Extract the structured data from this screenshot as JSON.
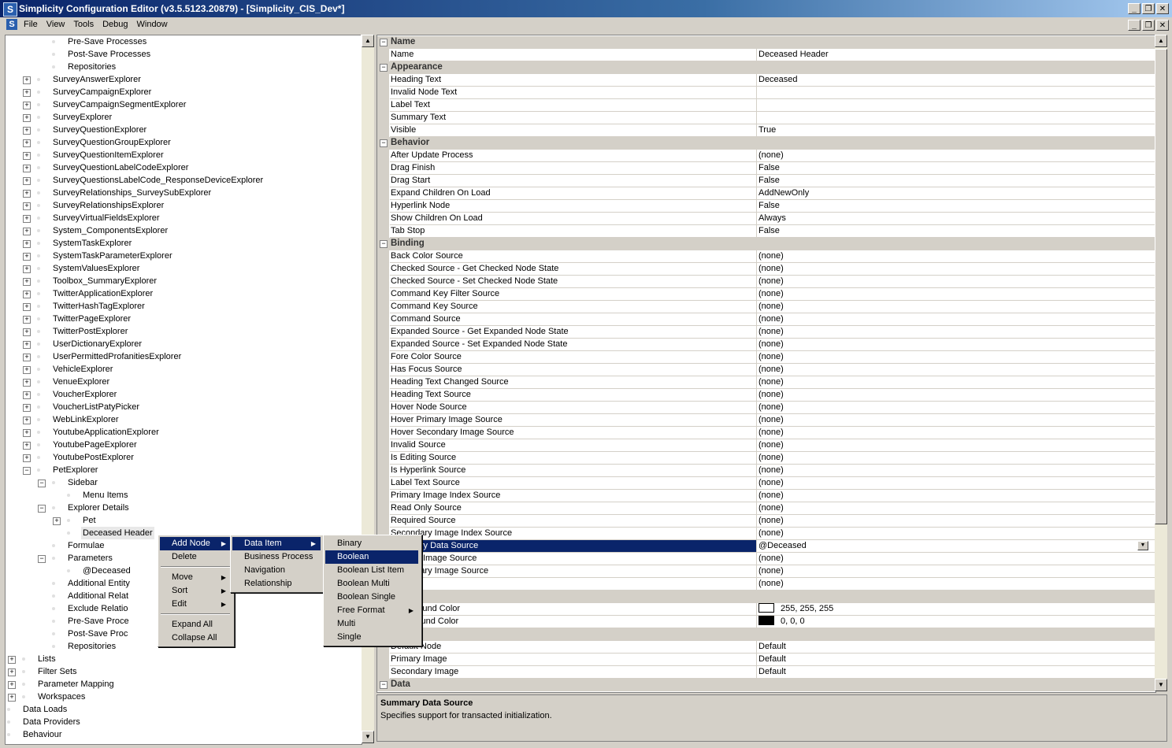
{
  "window": {
    "title": "Simplicity Configuration Editor (v3.5.5123.20879) - [Simplicity_CIS_Dev*]",
    "app_icon": "S",
    "minimize": "_",
    "restore": "❐",
    "close": "✕"
  },
  "menubar": {
    "icon": "S",
    "items": [
      "File",
      "View",
      "Tools",
      "Debug",
      "Window"
    ]
  },
  "tree": {
    "nodes": [
      {
        "label": "Pre-Save Processes",
        "level": 4,
        "exp": ""
      },
      {
        "label": "Post-Save Processes",
        "level": 4,
        "exp": ""
      },
      {
        "label": "Repositories",
        "level": 4,
        "exp": ""
      },
      {
        "label": "SurveyAnswerExplorer",
        "level": 3,
        "exp": "+"
      },
      {
        "label": "SurveyCampaignExplorer",
        "level": 3,
        "exp": "+"
      },
      {
        "label": "SurveyCampaignSegmentExplorer",
        "level": 3,
        "exp": "+"
      },
      {
        "label": "SurveyExplorer",
        "level": 3,
        "exp": "+"
      },
      {
        "label": "SurveyQuestionExplorer",
        "level": 3,
        "exp": "+"
      },
      {
        "label": "SurveyQuestionGroupExplorer",
        "level": 3,
        "exp": "+"
      },
      {
        "label": "SurveyQuestionItemExplorer",
        "level": 3,
        "exp": "+"
      },
      {
        "label": "SurveyQuestionLabelCodeExplorer",
        "level": 3,
        "exp": "+"
      },
      {
        "label": "SurveyQuestionsLabelCode_ResponseDeviceExplorer",
        "level": 3,
        "exp": "+"
      },
      {
        "label": "SurveyRelationships_SurveySubExplorer",
        "level": 3,
        "exp": "+"
      },
      {
        "label": "SurveyRelationshipsExplorer",
        "level": 3,
        "exp": "+"
      },
      {
        "label": "SurveyVirtualFieldsExplorer",
        "level": 3,
        "exp": "+"
      },
      {
        "label": "System_ComponentsExplorer",
        "level": 3,
        "exp": "+"
      },
      {
        "label": "SystemTaskExplorer",
        "level": 3,
        "exp": "+"
      },
      {
        "label": "SystemTaskParameterExplorer",
        "level": 3,
        "exp": "+"
      },
      {
        "label": "SystemValuesExplorer",
        "level": 3,
        "exp": "+"
      },
      {
        "label": "Toolbox_SummaryExplorer",
        "level": 3,
        "exp": "+"
      },
      {
        "label": "TwitterApplicationExplorer",
        "level": 3,
        "exp": "+"
      },
      {
        "label": "TwitterHashTagExplorer",
        "level": 3,
        "exp": "+"
      },
      {
        "label": "TwitterPageExplorer",
        "level": 3,
        "exp": "+"
      },
      {
        "label": "TwitterPostExplorer",
        "level": 3,
        "exp": "+"
      },
      {
        "label": "UserDictionaryExplorer",
        "level": 3,
        "exp": "+"
      },
      {
        "label": "UserPermittedProfanitiesExplorer",
        "level": 3,
        "exp": "+"
      },
      {
        "label": "VehicleExplorer",
        "level": 3,
        "exp": "+"
      },
      {
        "label": "VenueExplorer",
        "level": 3,
        "exp": "+"
      },
      {
        "label": "VoucherExplorer",
        "level": 3,
        "exp": "+"
      },
      {
        "label": "VoucherListPatyPicker",
        "level": 3,
        "exp": "+"
      },
      {
        "label": "WebLinkExplorer",
        "level": 3,
        "exp": "+"
      },
      {
        "label": "YoutubeApplicationExplorer",
        "level": 3,
        "exp": "+"
      },
      {
        "label": "YoutubePageExplorer",
        "level": 3,
        "exp": "+"
      },
      {
        "label": "YoutubePostExplorer",
        "level": 3,
        "exp": "+"
      },
      {
        "label": "PetExplorer",
        "level": 3,
        "exp": "−"
      },
      {
        "label": "Sidebar",
        "level": 4,
        "exp": "−"
      },
      {
        "label": "Menu Items",
        "level": 5,
        "exp": ""
      },
      {
        "label": "Explorer Details",
        "level": 4,
        "exp": "−"
      },
      {
        "label": "Pet",
        "level": 5,
        "exp": "+"
      },
      {
        "label": "Deceased Header",
        "level": 5,
        "exp": "",
        "selected": true
      },
      {
        "label": "Formulae",
        "level": 4,
        "exp": ""
      },
      {
        "label": "Parameters",
        "level": 4,
        "exp": "−"
      },
      {
        "label": "@Deceased",
        "level": 5,
        "exp": ""
      },
      {
        "label": "Additional Entity",
        "level": 4,
        "exp": ""
      },
      {
        "label": "Additional Relat",
        "level": 4,
        "exp": ""
      },
      {
        "label": "Exclude Relatio",
        "level": 4,
        "exp": ""
      },
      {
        "label": "Pre-Save Proce",
        "level": 4,
        "exp": ""
      },
      {
        "label": "Post-Save Proc",
        "level": 4,
        "exp": ""
      },
      {
        "label": "Repositories",
        "level": 4,
        "exp": ""
      },
      {
        "label": "Lists",
        "level": 2,
        "exp": "+"
      },
      {
        "label": "Filter Sets",
        "level": 2,
        "exp": "+"
      },
      {
        "label": "Parameter Mapping",
        "level": 2,
        "exp": "+"
      },
      {
        "label": "Workspaces",
        "level": 2,
        "exp": "+"
      },
      {
        "label": "Data Loads",
        "level": 1,
        "exp": "+"
      },
      {
        "label": "Data Providers",
        "level": 1,
        "exp": "+"
      },
      {
        "label": "Behaviour",
        "level": 1,
        "exp": "+"
      }
    ]
  },
  "properties": {
    "rows": [
      {
        "cat": "Name"
      },
      {
        "name": "Name",
        "value": "Deceased Header"
      },
      {
        "cat": "Appearance"
      },
      {
        "name": "Heading Text",
        "value": "Deceased"
      },
      {
        "name": "Invalid Node Text",
        "value": ""
      },
      {
        "name": "Label Text",
        "value": ""
      },
      {
        "name": "Summary Text",
        "value": ""
      },
      {
        "name": "Visible",
        "value": "True"
      },
      {
        "cat": "Behavior"
      },
      {
        "name": "After Update Process",
        "value": "(none)"
      },
      {
        "name": "Drag Finish",
        "value": "False"
      },
      {
        "name": "Drag Start",
        "value": "False"
      },
      {
        "name": "Expand Children On Load",
        "value": "AddNewOnly"
      },
      {
        "name": "Hyperlink Node",
        "value": "False"
      },
      {
        "name": "Show Children On Load",
        "value": "Always"
      },
      {
        "name": "Tab Stop",
        "value": "False"
      },
      {
        "cat": "Binding"
      },
      {
        "name": "Back Color Source",
        "value": "(none)"
      },
      {
        "name": "Checked Source - Get Checked Node State",
        "value": "(none)"
      },
      {
        "name": "Checked Source - Set Checked Node State",
        "value": "(none)"
      },
      {
        "name": "Command Key Filter Source",
        "value": "(none)"
      },
      {
        "name": "Command Key Source",
        "value": "(none)"
      },
      {
        "name": "Command Source",
        "value": "(none)"
      },
      {
        "name": "Expanded Source - Get Expanded Node State",
        "value": "(none)"
      },
      {
        "name": "Expanded Source - Set Expanded Node State",
        "value": "(none)"
      },
      {
        "name": "Fore Color Source",
        "value": "(none)"
      },
      {
        "name": "Has Focus Source",
        "value": "(none)"
      },
      {
        "name": "Heading Text Changed Source",
        "value": "(none)"
      },
      {
        "name": "Heading Text Source",
        "value": "(none)"
      },
      {
        "name": "Hover Node Source",
        "value": "(none)"
      },
      {
        "name": "Hover Primary Image Source",
        "value": "(none)"
      },
      {
        "name": "Hover Secondary Image Source",
        "value": "(none)"
      },
      {
        "name": "Invalid Source",
        "value": "(none)"
      },
      {
        "name": "Is Editing Source",
        "value": "(none)"
      },
      {
        "name": "Is Hyperlink Source",
        "value": "(none)"
      },
      {
        "name": "Label Text Source",
        "value": "(none)"
      },
      {
        "name": "Primary Image Index Source",
        "value": "(none)"
      },
      {
        "name": "Read Only Source",
        "value": "(none)"
      },
      {
        "name": "Required Source",
        "value": "(none)"
      },
      {
        "name": "Secondary Image Index Source",
        "value": "(none)"
      },
      {
        "name": "Summary Data Source",
        "value": "@Deceased",
        "selected": true,
        "dropdown": true
      },
      {
        "name": "Primary Image Source",
        "value": "(none)"
      },
      {
        "name": "Secondary Image Source",
        "value": "(none)"
      },
      {
        "name": "Source",
        "value": "(none)"
      },
      {
        "cat": ""
      },
      {
        "name": "Background Color",
        "value": "255, 255, 255",
        "swatch": "#ffffff"
      },
      {
        "name": "Foreground Color",
        "value": "0, 0, 0",
        "swatch": "#000000"
      },
      {
        "cat": ""
      },
      {
        "name": "Default Node",
        "value": "Default"
      },
      {
        "name": "Primary Image",
        "value": "Default"
      },
      {
        "name": "Secondary Image",
        "value": "Default"
      },
      {
        "cat": "Data"
      }
    ]
  },
  "description": {
    "title": "Summary Data Source",
    "text": "Specifies support for transacted initialization."
  },
  "context_menu": {
    "items": [
      {
        "label": "Add Node",
        "arrow": true,
        "highlight": true
      },
      {
        "label": "Delete"
      },
      {
        "sep": true
      },
      {
        "label": "Move",
        "arrow": true
      },
      {
        "label": "Sort",
        "arrow": true
      },
      {
        "label": "Edit",
        "arrow": true
      },
      {
        "sep": true
      },
      {
        "label": "Expand All"
      },
      {
        "label": "Collapse All"
      }
    ]
  },
  "submenu1": {
    "items": [
      {
        "label": "Data Item",
        "arrow": true,
        "highlight": true
      },
      {
        "label": "Business Process"
      },
      {
        "label": "Navigation"
      },
      {
        "label": "Relationship"
      }
    ]
  },
  "submenu2": {
    "items": [
      {
        "label": "Binary"
      },
      {
        "label": "Boolean",
        "highlight": true
      },
      {
        "label": "Boolean List Item"
      },
      {
        "label": "Boolean Multi"
      },
      {
        "label": "Boolean Single"
      },
      {
        "label": "Free Format",
        "arrow": true
      },
      {
        "label": "Multi"
      },
      {
        "label": "Single"
      }
    ]
  },
  "colors": {
    "selection": "#0a246a",
    "chrome": "#d4d0c8"
  },
  "icons": {
    "expand": "plus-box-icon",
    "collapse": "minus-box-icon",
    "submenu_arrow": "▶",
    "scroll_up": "▲",
    "scroll_down": "▼",
    "dropdown": "▼"
  }
}
